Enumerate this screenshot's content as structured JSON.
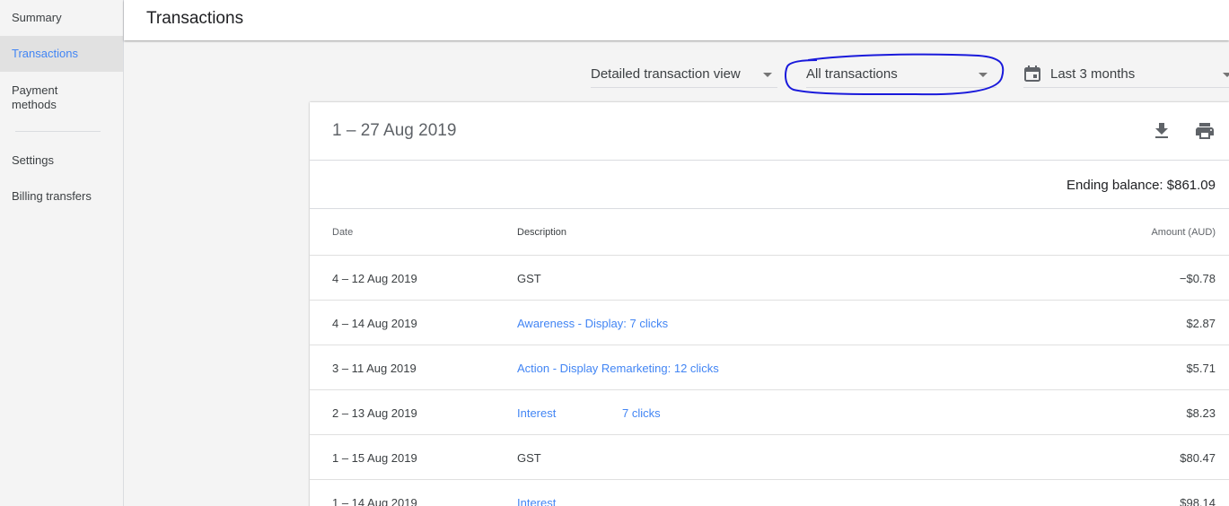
{
  "sidebar": {
    "items": [
      {
        "label": "Summary"
      },
      {
        "label": "Transactions"
      },
      {
        "label": "Payment methods"
      },
      {
        "label": "Settings"
      },
      {
        "label": "Billing transfers"
      }
    ],
    "active": "Transactions"
  },
  "header": {
    "title": "Transactions"
  },
  "filters": {
    "view": "Detailed transaction view",
    "type": "All transactions",
    "range": "Last 3 months"
  },
  "card": {
    "period": "1 – 27 Aug 2019",
    "ending_balance": "Ending balance: $861.09",
    "columns": {
      "date": "Date",
      "description": "Description",
      "amount": "Amount (AUD)"
    },
    "rows": [
      {
        "date": "4 – 12 Aug 2019",
        "description": "GST",
        "amount": "−$0.78"
      },
      {
        "date": "4 – 14 Aug 2019",
        "description": "Awareness - Display: 7 clicks",
        "amount": "$2.87"
      },
      {
        "date": "3 – 11 Aug 2019",
        "description": "Action - Display Remarketing: 12 clicks",
        "amount": "$5.71"
      },
      {
        "date": "2 – 13 Aug 2019",
        "description": "Interest",
        "description_extra": "7 clicks",
        "amount": "$8.23"
      },
      {
        "date": "1 – 15 Aug 2019",
        "description": "GST",
        "amount": "$80.47"
      },
      {
        "date": "1 – 14 Aug 2019",
        "description": "Interest",
        "amount": "$98.14"
      }
    ]
  },
  "colors": {
    "accent": "#4285f4",
    "annotation": "#1a1adb"
  },
  "icons": [
    "download-icon",
    "print-icon",
    "calendar-icon",
    "dropdown-caret-icon"
  ]
}
